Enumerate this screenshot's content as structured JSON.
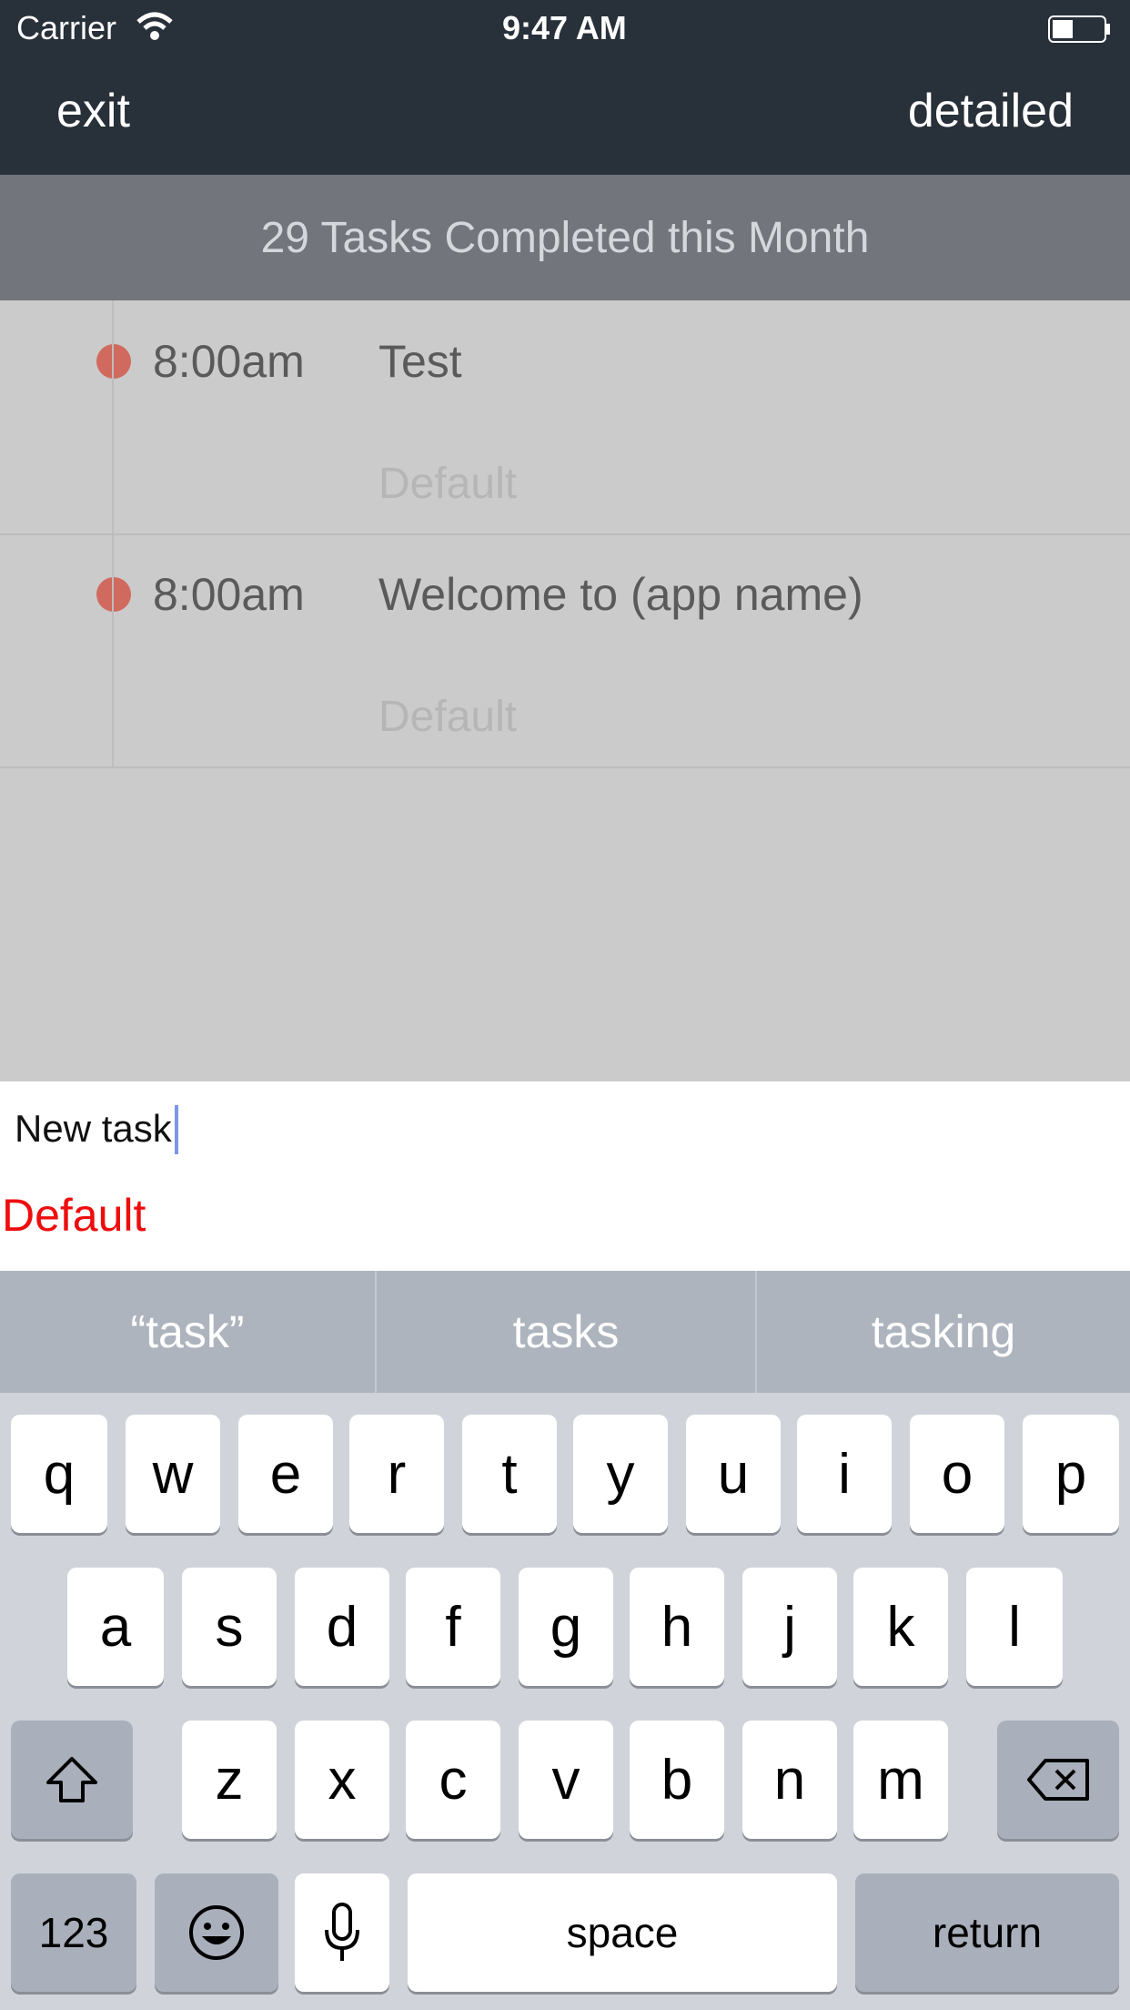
{
  "status_bar": {
    "carrier": "Carrier",
    "time": "9:47 AM"
  },
  "nav": {
    "left": "exit",
    "right": "detailed"
  },
  "banner": "29 Tasks Completed this Month",
  "tasks": [
    {
      "time": "8:00am",
      "title": "Test",
      "category": "Default"
    },
    {
      "time": "8:00am",
      "title": "Welcome to (app name)",
      "category": "Default"
    }
  ],
  "input": {
    "value": "New task",
    "category": "Default"
  },
  "suggestions": [
    "“task”",
    "tasks",
    "tasking"
  ],
  "keyboard": {
    "row1": [
      "q",
      "w",
      "e",
      "r",
      "t",
      "y",
      "u",
      "i",
      "o",
      "p"
    ],
    "row2": [
      "a",
      "s",
      "d",
      "f",
      "g",
      "h",
      "j",
      "k",
      "l"
    ],
    "row3": [
      "z",
      "x",
      "c",
      "v",
      "b",
      "n",
      "m"
    ],
    "numbers": "123",
    "space": "space",
    "return": "return"
  },
  "colors": {
    "nav_bg": "#283039",
    "dot": "#d06a5e",
    "category_red": "#ee0d0d",
    "caret": "#7d95e8"
  }
}
